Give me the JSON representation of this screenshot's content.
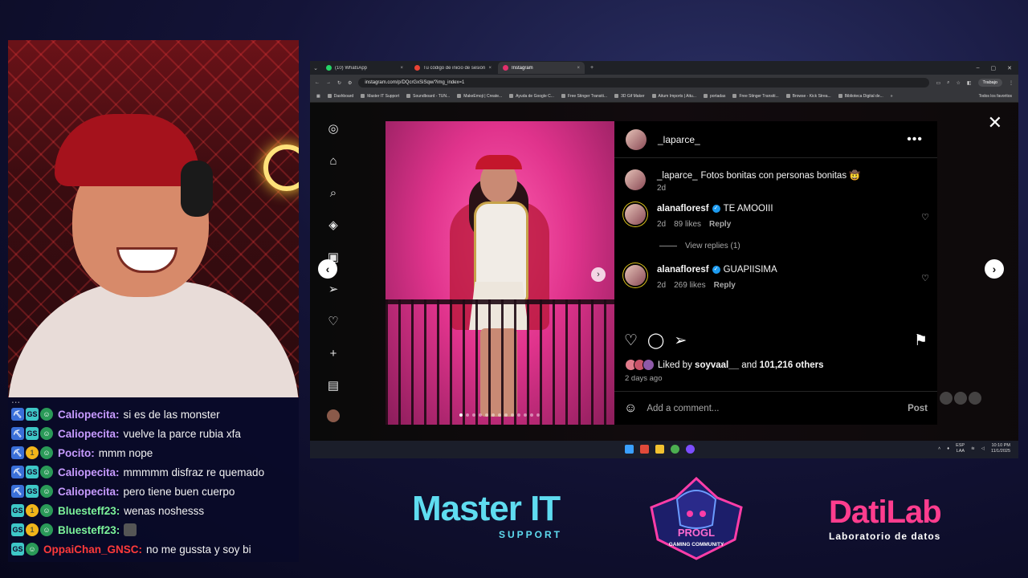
{
  "chat": [
    {
      "badges": [
        "pick",
        "sub",
        "avatar"
      ],
      "user": "Caliopecita:",
      "color": "purple",
      "text": "si es de las monster"
    },
    {
      "badges": [
        "pick",
        "sub",
        "avatar"
      ],
      "user": "Caliopecita:",
      "color": "purple",
      "text": "vuelve la parce rubia xfa"
    },
    {
      "badges": [
        "pick",
        "coin",
        "avatar"
      ],
      "user": "Pocito:",
      "color": "purple",
      "text": "mmm nope"
    },
    {
      "badges": [
        "pick",
        "sub",
        "avatar"
      ],
      "user": "Caliopecita:",
      "color": "purple",
      "text": "mmmmm disfraz re quemado"
    },
    {
      "badges": [
        "pick",
        "sub",
        "avatar"
      ],
      "user": "Caliopecita:",
      "color": "purple",
      "text": "pero tiene buen cuerpo"
    },
    {
      "badges": [
        "sub",
        "coin",
        "avatar"
      ],
      "user": "Bluesteff23:",
      "color": "green",
      "text": "wenas noshesss"
    },
    {
      "badges": [
        "sub",
        "coin",
        "avatar"
      ],
      "user": "Bluesteff23:",
      "color": "green",
      "text": ""
    },
    {
      "badges": [
        "sub",
        "avatar"
      ],
      "user": "OppaiChan_GNSC:",
      "color": "red",
      "text": "no me gussta y soy bi"
    }
  ],
  "browser": {
    "tabs": [
      {
        "label": "(10) WhatsApp",
        "color": "#25d366",
        "active": false
      },
      {
        "label": "Tu código de inicio de sesión es",
        "color": "#ea4335",
        "active": false
      },
      {
        "label": "Instagram",
        "color": "#e1306c",
        "active": true
      }
    ],
    "url": "instagram.com/p/DQcrGxSiSqw/?img_index=1",
    "profile": "Trabajo",
    "bookmarks": [
      "Dashboard",
      "Master IT Support",
      "Soundboard - TUN...",
      "MakeEmoji | Create...",
      "Ayuda de Google C...",
      "Free Stinger Transiti...",
      "3D Gif Maker",
      "Aitum Imports | Aitu...",
      "portadas",
      "Free Stinger Transiti...",
      "Browse - Kick Strea...",
      "Biblioteca Digital de..."
    ],
    "all_bookmarks": "Todos los favoritos"
  },
  "post": {
    "username": "_laparce_",
    "caption_user": "_laparce_",
    "caption": "Fotos bonitas con personas bonitas 🤠",
    "caption_age": "2d",
    "comments": [
      {
        "user": "alanafloresf",
        "text": "TE AMOOIII",
        "age": "2d",
        "likes": "89 likes",
        "reply": "Reply"
      },
      {
        "user": "alanafloresf",
        "text": "GUAPIISIMA",
        "age": "2d",
        "likes": "269 likes",
        "reply": "Reply"
      }
    ],
    "view_replies": "View replies (1)",
    "liked_by_prefix": "Liked by",
    "liked_by_user": "soyvaal__",
    "liked_by_and": "and",
    "liked_by_others": "101,216 others",
    "time_ago": "2 days ago",
    "add_comment_placeholder": "Add a comment...",
    "post_button": "Post"
  },
  "taskbar": {
    "lang1": "ESP",
    "lang2": "LAA",
    "time": "10:10 PM",
    "date": "11/1/2025"
  },
  "logos": {
    "master_main": "Master IT",
    "master_sub": "SUPPORT",
    "gaming_main": "PROGL",
    "gaming_sub": "GAMING COMMUNITY",
    "datilab_main": "DatiLab",
    "datilab_sub": "Laboratorio de datos"
  }
}
